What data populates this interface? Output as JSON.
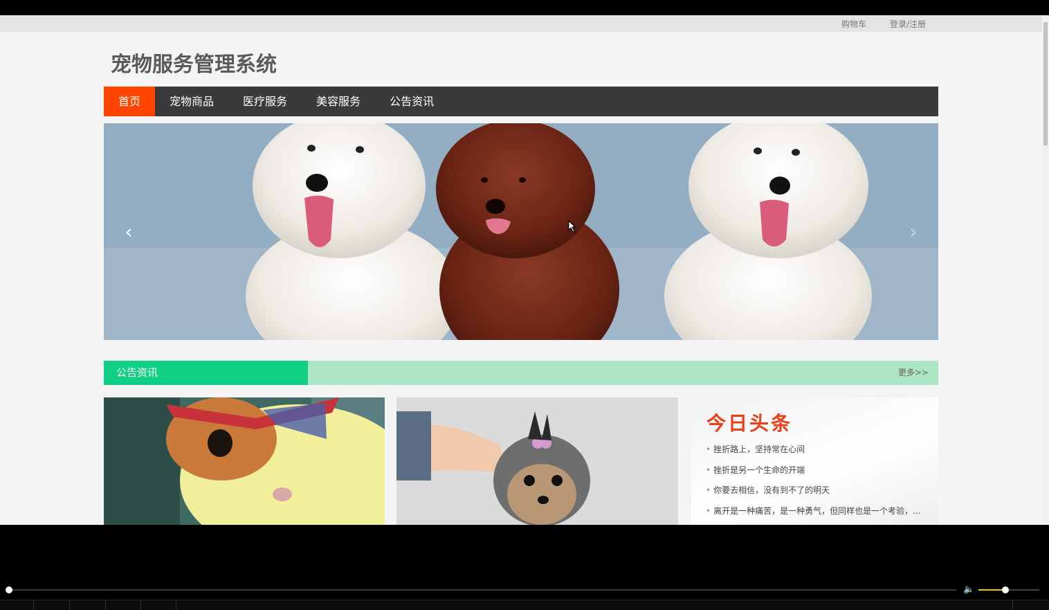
{
  "topbar": {
    "cart": "购物车",
    "login": "登录/注册"
  },
  "site": {
    "title": "宠物服务管理系统"
  },
  "nav": {
    "items": [
      "首页",
      "宠物商品",
      "医疗服务",
      "美容服务",
      "公告资讯"
    ],
    "active": "首页"
  },
  "banner": {
    "prev": "‹",
    "next": "›"
  },
  "section": {
    "title": "公告资讯",
    "more": "更多>>"
  },
  "news": {
    "heading": "今日头条",
    "items": [
      "挫折路上，坚持常在心间",
      "挫折是另一个生命的开端",
      "你要去相信，没有到不了的明天",
      "离开是一种痛苦，是一种勇气，但同样也是一个考验，..."
    ]
  },
  "player": {
    "volume_percent": 45
  },
  "colors": {
    "nav_active": "#ff4500",
    "nav_bg": "#3a3a3a",
    "section_tab": "#12cf86",
    "section_bar": "#abe5c1",
    "news_heading": "#e8401a"
  }
}
